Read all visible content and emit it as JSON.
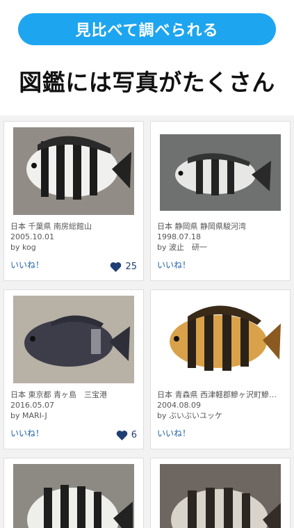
{
  "banner": {
    "label": "見比べて調べられる"
  },
  "headline": "図鑑には写真がたくさん",
  "cards": [
    {
      "location": "日本 千葉県 南房総館山",
      "date": "2005.10.01",
      "author": "by kog",
      "like_label": "いいね！",
      "likes": "25"
    },
    {
      "location": "日本 静岡県 静岡県駿河湾",
      "date": "1998.07.18",
      "author": "by 波止　研一",
      "like_label": "いいね！",
      "likes": ""
    },
    {
      "location": "日本 東京都 青ヶ島　三宝港",
      "date": "2016.05.07",
      "author": "by MARI-J",
      "like_label": "いいね！",
      "likes": "6"
    },
    {
      "location": "日本 青森県 西津軽郡鰺ヶ沢町鰺…",
      "date": "2004.08.09",
      "author": "by ぶいぶいユッケ",
      "like_label": "いいね！",
      "likes": ""
    },
    {
      "location": "",
      "date": "",
      "author": "",
      "like_label": "",
      "likes": ""
    },
    {
      "location": "",
      "date": "",
      "author": "",
      "like_label": "",
      "likes": ""
    }
  ],
  "colors": {
    "accent": "#1ea5ef",
    "link": "#1f5fa6",
    "heart": "#1f3f73"
  },
  "icons": {
    "heart": "heart-icon",
    "fish_photo": "fish-photo"
  }
}
